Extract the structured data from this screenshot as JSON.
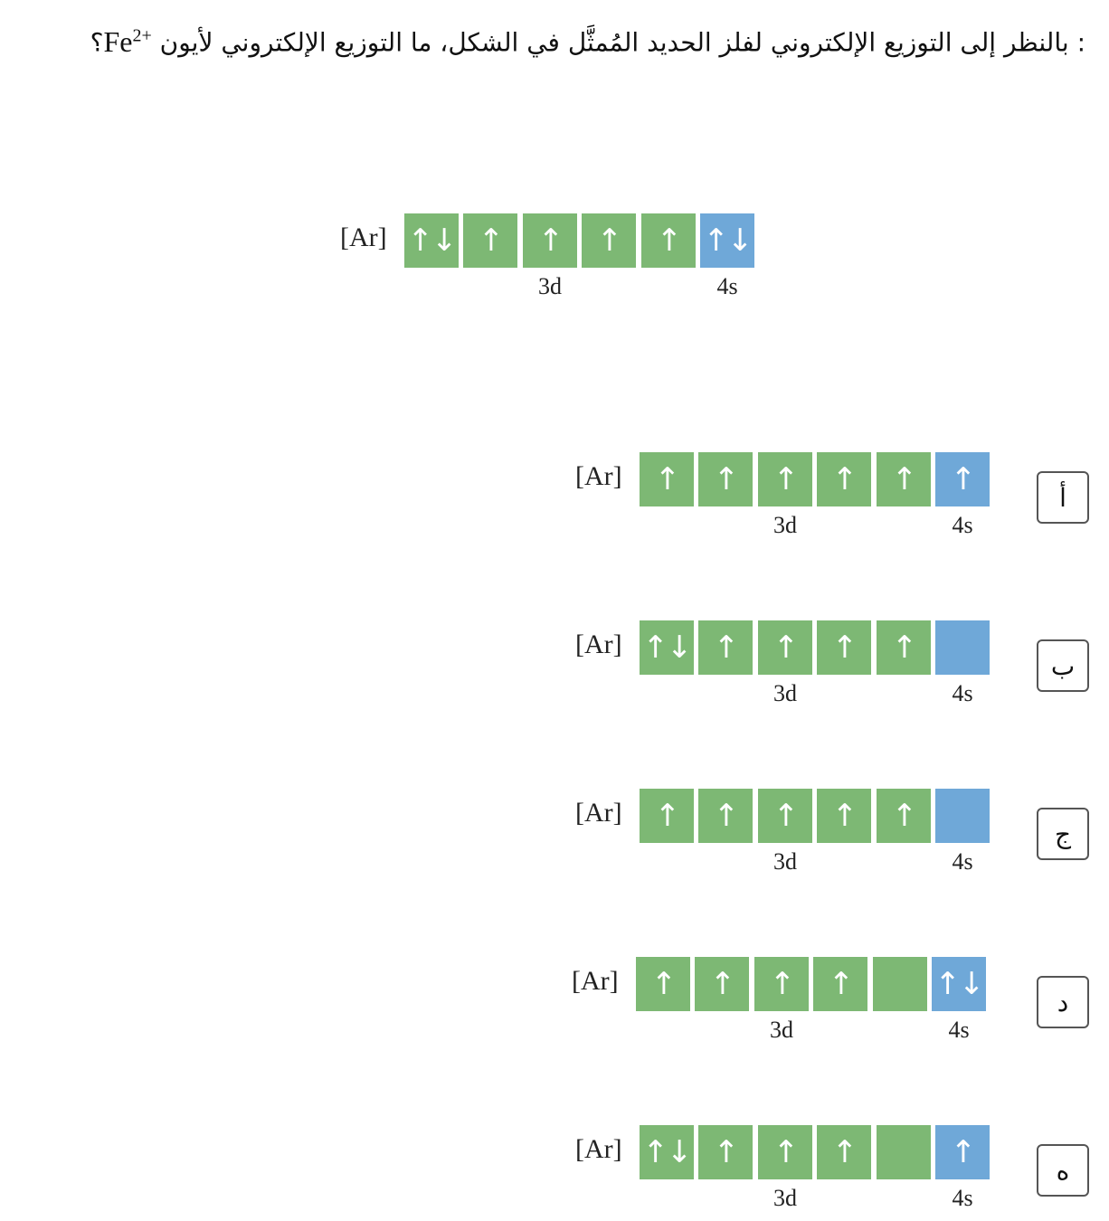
{
  "question": {
    "text": ": بالنظر إلى التوزيع الإلكتروني لفلز الحديد المُمثَّل في الشكل، ما التوزيع الإلكتروني لأيون",
    "ion_base": "Fe",
    "ion_charge": "2+",
    "question_mark": "؟"
  },
  "labels": {
    "core": "[Ar]",
    "d_label": "3d",
    "s_label": "4s"
  },
  "reference": {
    "d_orbitals": [
      "↑↓",
      "↑",
      "↑",
      "↑",
      "↑"
    ],
    "s_orbital": "↑↓"
  },
  "options": [
    {
      "letter": "أ",
      "d_orbitals": [
        "↑",
        "↑",
        "↑",
        "↑",
        "↑"
      ],
      "s_orbital": "↑"
    },
    {
      "letter": "ب",
      "d_orbitals": [
        "↑↓",
        "↑",
        "↑",
        "↑",
        "↑"
      ],
      "s_orbital": ""
    },
    {
      "letter": "ج",
      "d_orbitals": [
        "↑",
        "↑",
        "↑",
        "↑",
        "↑"
      ],
      "s_orbital": ""
    },
    {
      "letter": "د",
      "d_orbitals": [
        "↑",
        "↑",
        "↑",
        "↑",
        ""
      ],
      "s_orbital": "↑↓"
    },
    {
      "letter": "ه",
      "d_orbitals": [
        "↑↓",
        "↑",
        "↑",
        "↑",
        ""
      ],
      "s_orbital": "↑"
    }
  ],
  "colors": {
    "d_box": "#7db874",
    "s_box": "#6fa8d8"
  }
}
